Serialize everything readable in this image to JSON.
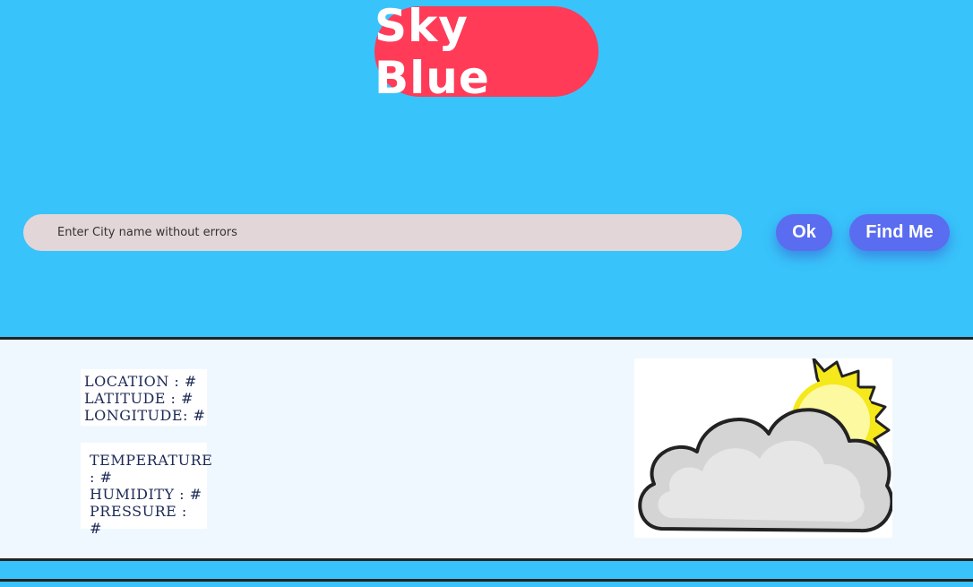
{
  "header": {
    "title": "Sky Blue"
  },
  "search": {
    "placeholder": "Enter City name without errors",
    "ok_label": "Ok",
    "find_me_label": "Find Me"
  },
  "location_card": {
    "location": "LOCATION : #",
    "latitude": "LATITUDE : #",
    "longitude": "LONGITUDE: #"
  },
  "weather_card": {
    "temperature": "TEMPERATURE : #",
    "humidity": "HUMIDITY : #",
    "pressure": "PRESSURE : #"
  },
  "weather_image": {
    "icon": "partly-cloudy-icon"
  },
  "colors": {
    "page_background": "#38c3fa",
    "title_pill": "#ff3b58",
    "button": "#5a6cf0",
    "search_field": "#e2d6d8",
    "content_panel": "#f0f8ff",
    "sun": "#f5e81b",
    "cloud": "#d2d2d2"
  }
}
